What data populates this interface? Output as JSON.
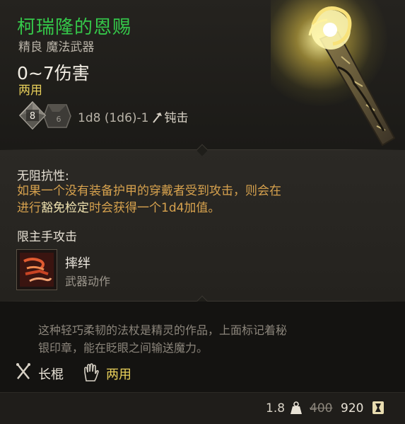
{
  "item": {
    "name": "柯瑞隆的恩赐",
    "rarity_type": "精良 魔法武器",
    "damage": "0~7伤害",
    "handedness": "两用",
    "dice_main": "8",
    "dice_alt": "6",
    "dice_formula": "1d8 (1d6)-1",
    "damage_type": "钝击"
  },
  "passive": {
    "name": "无阻抗性:",
    "desc_line1": "如果一个没有装备护甲的穿戴者受到攻击，则会在",
    "desc_line2_pre": "进行",
    "desc_keyword": "豁免检定",
    "desc_line2_post": "时会获得一个1d4加值。"
  },
  "mainhand": {
    "header": "限主手攻击",
    "action_name": "摔绊",
    "action_type": "武器动作"
  },
  "flavor": {
    "line1": "这种轻巧柔韧的法杖是精灵的作品，上面标记着秘",
    "line2": "银印章，能在眨眼之间输送魔力。"
  },
  "proficiency": {
    "weapon_type": "长棍",
    "grip": "两用"
  },
  "footer": {
    "weight": "1.8",
    "old_price": "400",
    "new_price": "920"
  },
  "colors": {
    "title_green": "#35c84a",
    "gold": "#e8cf5a",
    "orange_desc": "#d7a24e"
  },
  "icons": [
    "d8-die-icon",
    "d6-die-icon",
    "hammer-icon",
    "trip-action-icon",
    "staff-proficiency-icon",
    "hand-icon",
    "weight-icon",
    "coin-icon"
  ]
}
